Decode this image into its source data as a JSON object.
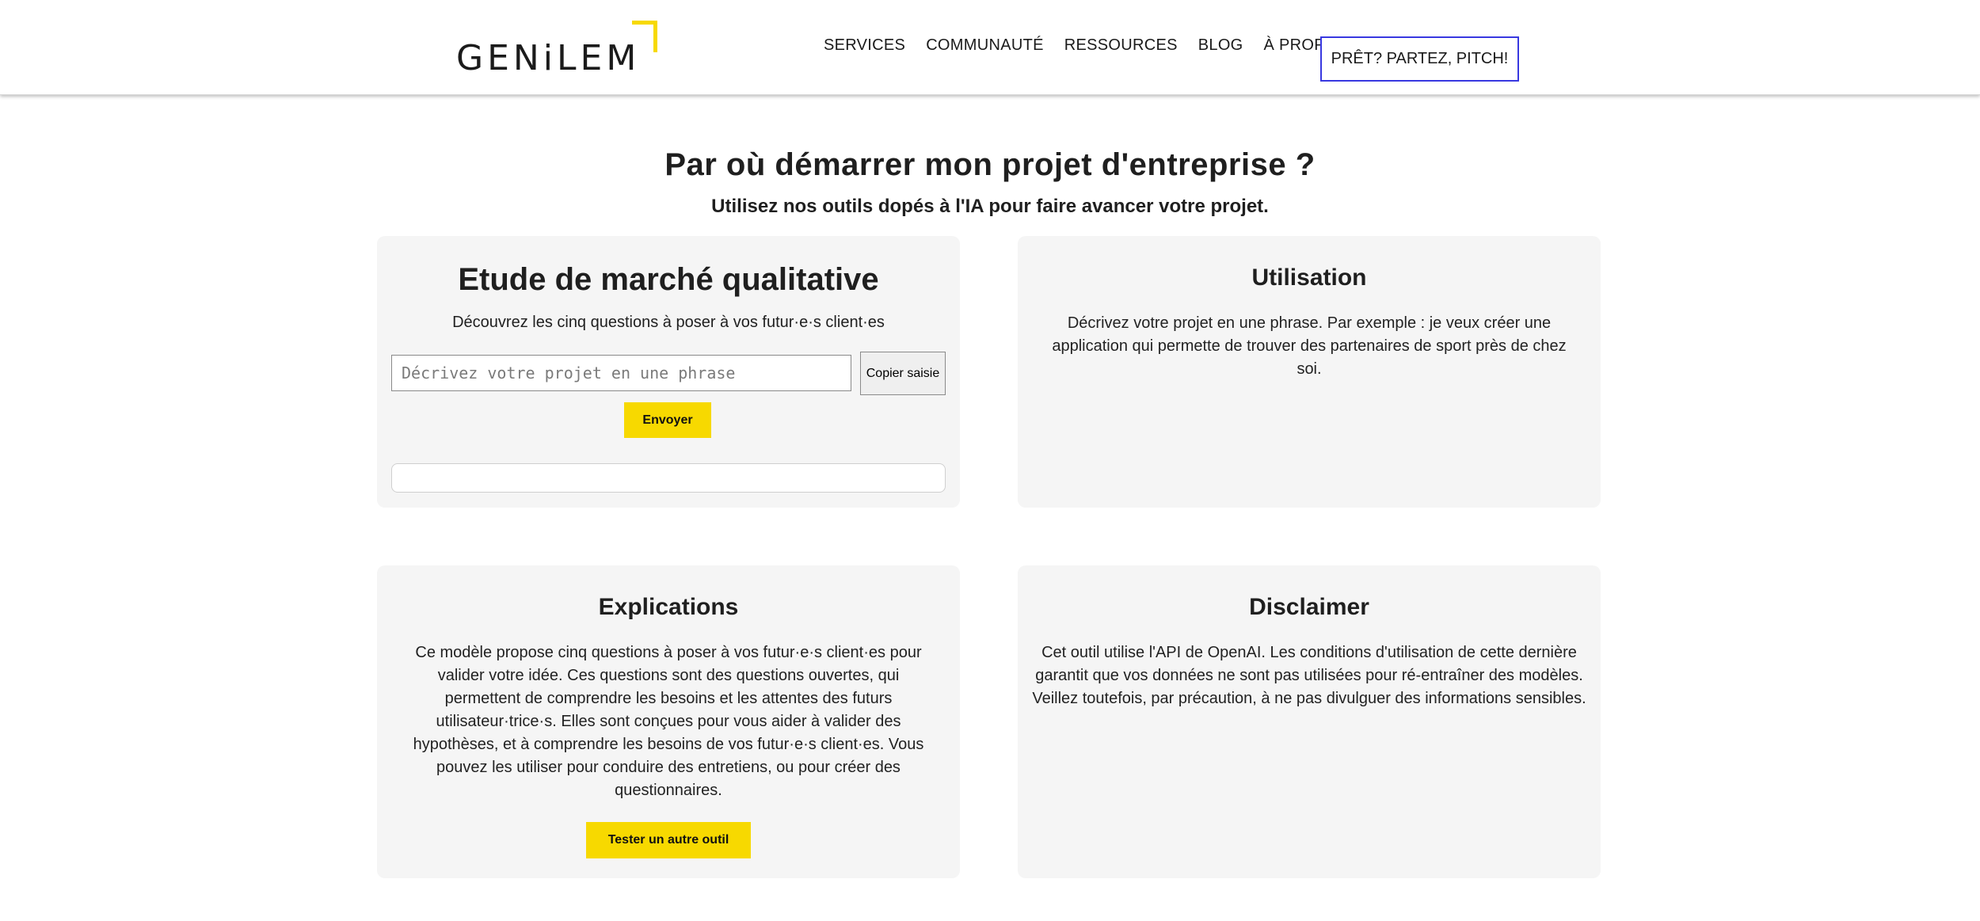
{
  "header": {
    "logo_text": "GENiLEM",
    "nav": [
      "SERVICES",
      "COMMUNAUTÉ",
      "RESSOURCES",
      "BLOG",
      "À PROPOS"
    ],
    "cta": "PRÊT? PARTEZ, PITCH!"
  },
  "page": {
    "title": "Par où démarrer mon projet d'entreprise ?",
    "subtitle": "Utilisez nos outils dopés à l'IA pour faire avancer votre projet."
  },
  "etude": {
    "title": "Etude de marché qualitative",
    "lead": "Découvrez les cinq questions à poser à vos futur·e·s client·es",
    "input_placeholder": "Décrivez votre projet en une phrase",
    "input_value": "",
    "copy_button": "Copier saisie",
    "send_button": "Envoyer",
    "result": ""
  },
  "utilisation": {
    "title": "Utilisation",
    "text": "Décrivez votre projet en une phrase. Par exemple : je veux créer une application qui permette de trouver des partenaires de sport près de chez soi."
  },
  "explications": {
    "title": "Explications",
    "text": "Ce modèle propose cinq questions à poser à vos futur·e·s client·es pour valider votre idée. Ces questions sont des questions ouvertes, qui permettent de comprendre les besoins et les attentes des futurs utilisateur·trice·s. Elles sont conçues pour vous aider à valider des hypothèses, et à comprendre les besoins de vos futur·e·s client·es. Vous pouvez les utiliser pour conduire des entretiens, ou pour créer des questionnaires.",
    "button": "Tester un autre outil"
  },
  "disclaimer": {
    "title": "Disclaimer",
    "text": "Cet outil utilise l'API de OpenAI. Les conditions d'utilisation de cette dernière garantit que vos données ne sont pas utilisées pour ré-entraîner des modèles. Veillez toutefois, par précaution, à ne pas divulguer des informations sensibles."
  },
  "colors": {
    "accent": "#f7d900",
    "cta_border": "#3838e0",
    "card_bg": "#f5f5f5"
  }
}
